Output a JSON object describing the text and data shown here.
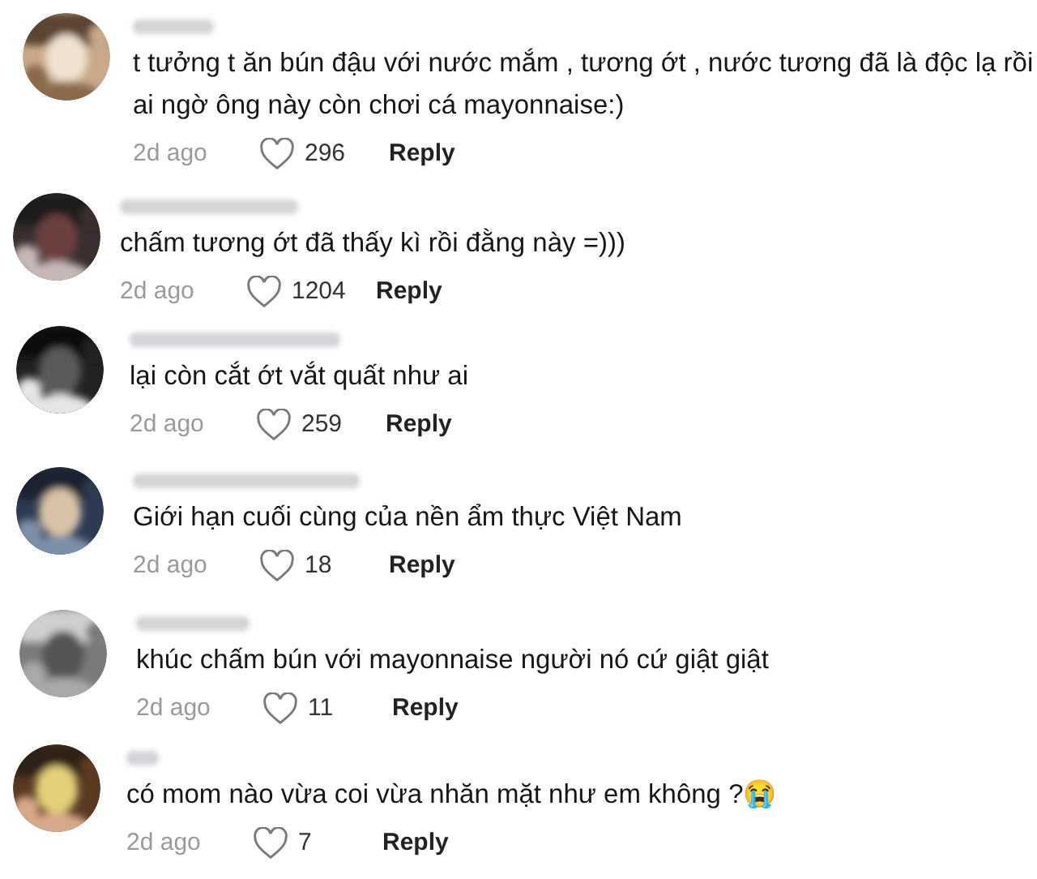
{
  "comments": [
    {
      "text": "t tưởng t ăn bún đậu với nước mắm , tương ớt , nước tương đã là độc lạ rồi ai ngờ ông này còn chơi cá mayonnaise:)",
      "time": "2d ago",
      "likes": "296",
      "reply": "Reply"
    },
    {
      "text": "chấm tương ớt đã thấy kì rồi đằng này =)))",
      "time": "2d ago",
      "likes": "1204",
      "reply": "Reply"
    },
    {
      "text": "lại còn cắt ớt vắt quất như ai",
      "time": "2d ago",
      "likes": "259",
      "reply": "Reply"
    },
    {
      "text": "Giới hạn cuối cùng của nền ẩm thực Việt Nam",
      "time": "2d ago",
      "likes": "18",
      "reply": "Reply"
    },
    {
      "text": "khúc chấm bún với mayonnaise người nó cứ giật giật",
      "time": "2d ago",
      "likes": "11",
      "reply": "Reply"
    },
    {
      "text": "có mom nào vừa coi vừa nhăn mặt như em không ?😭",
      "time": "2d ago",
      "likes": "7",
      "reply": "Reply"
    }
  ]
}
